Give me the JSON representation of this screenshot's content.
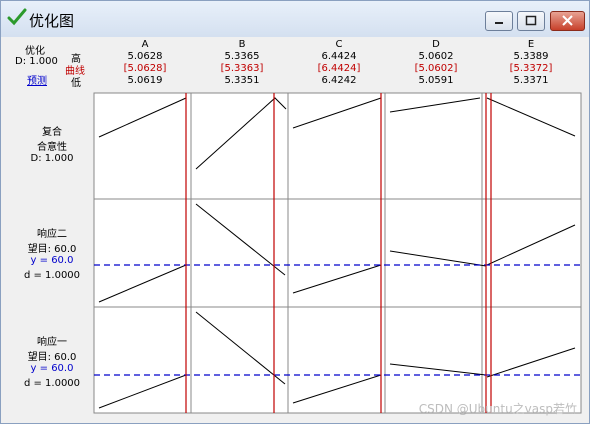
{
  "window": {
    "title": "优化图"
  },
  "left_header": {
    "opt_label": "优化",
    "d_label": "D: 1.000",
    "predict_link": "预测",
    "high_label": "高",
    "curve_label": "曲线",
    "low_label": "低"
  },
  "factors": [
    {
      "name": "A",
      "high": "5.0628",
      "current": "[5.0628]",
      "low": "5.0619"
    },
    {
      "name": "B",
      "high": "5.3365",
      "current": "[5.3363]",
      "low": "5.3351"
    },
    {
      "name": "C",
      "high": "6.4424",
      "current": "[6.4424]",
      "low": "6.4242"
    },
    {
      "name": "D",
      "high": "5.0602",
      "current": "[5.0602]",
      "low": "5.0591"
    },
    {
      "name": "E",
      "high": "5.3389",
      "current": "[5.3372]",
      "low": "5.3371"
    }
  ],
  "rows": [
    {
      "line1": "复合",
      "line2": "合意性",
      "line3": "D: 1.000",
      "line4": ""
    },
    {
      "line1": "响应二",
      "line2": "望目: 60.0",
      "line3": "y = 60.0",
      "line4": "d = 1.0000"
    },
    {
      "line1": "响应一",
      "line2": "望目: 60.0",
      "line3": "y = 60.0",
      "line4": "d = 1.0000"
    }
  ],
  "watermark": "CSDN @Ubuntu之vasp若竹",
  "colors": {
    "curve": "#000000",
    "current_line": "#c00000",
    "target_line": "#0000cc"
  }
}
